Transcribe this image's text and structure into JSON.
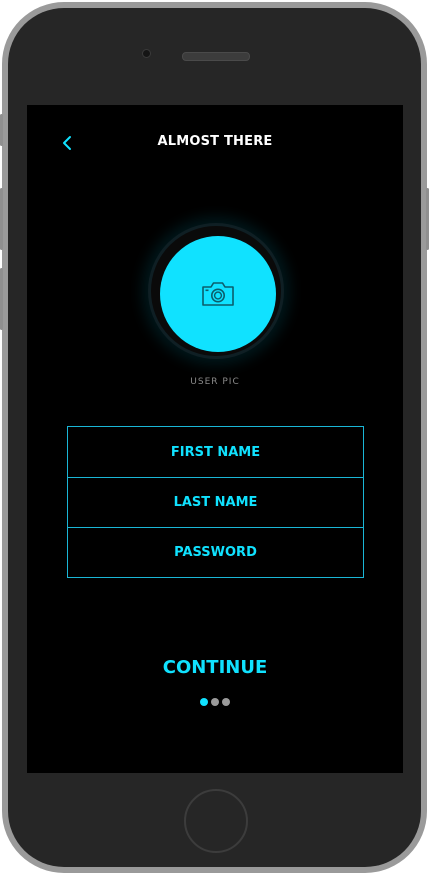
{
  "header": {
    "title": "ALMOST THERE",
    "back_icon": "chevron-left-icon"
  },
  "avatar": {
    "icon": "camera-icon",
    "label": "USER PIC"
  },
  "form": {
    "fields": [
      {
        "label": "FIRST NAME"
      },
      {
        "label": "LAST NAME"
      },
      {
        "label": "PASSWORD"
      }
    ]
  },
  "actions": {
    "continue_label": "CONTINUE"
  },
  "pager": {
    "total": 3,
    "current": 1
  },
  "colors": {
    "accent": "#10e2ff",
    "background": "#000000",
    "device": "#262626"
  }
}
